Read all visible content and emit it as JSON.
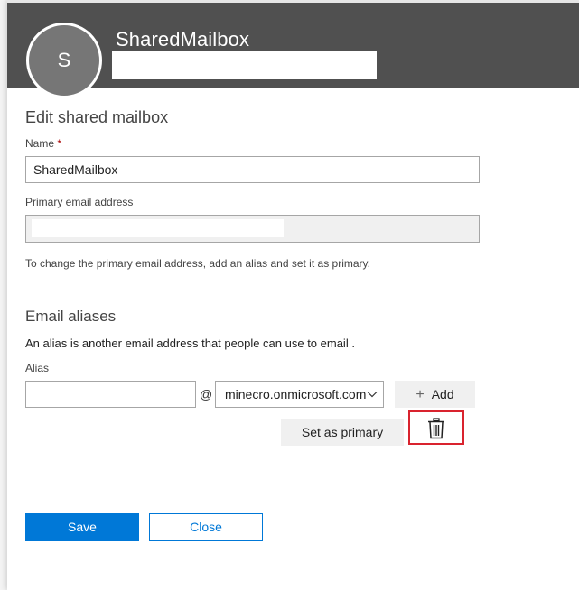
{
  "header": {
    "avatar_initial": "S",
    "display_name": "SharedMailbox"
  },
  "form": {
    "title": "Edit shared mailbox",
    "name_label": "Name",
    "required_mark": "*",
    "name_value": "SharedMailbox",
    "primary_email_label": "Primary email address",
    "primary_email_help": "To change the primary email address, add an alias and set it as primary."
  },
  "aliases": {
    "heading": "Email aliases",
    "description": "An alias is another email address that people can use to email .",
    "alias_label": "Alias",
    "alias_value": "",
    "at_symbol": "@",
    "domain_selected": "minecro.onmicrosoft.com",
    "add_label": "Add",
    "set_primary_label": "Set as primary"
  },
  "footer": {
    "save_label": "Save",
    "close_label": "Close"
  },
  "colors": {
    "header_bg": "#505050",
    "accent": "#0078d7",
    "highlight": "#d9232e"
  },
  "icons": [
    "plus-icon",
    "chevron-down-icon",
    "trash-icon"
  ]
}
